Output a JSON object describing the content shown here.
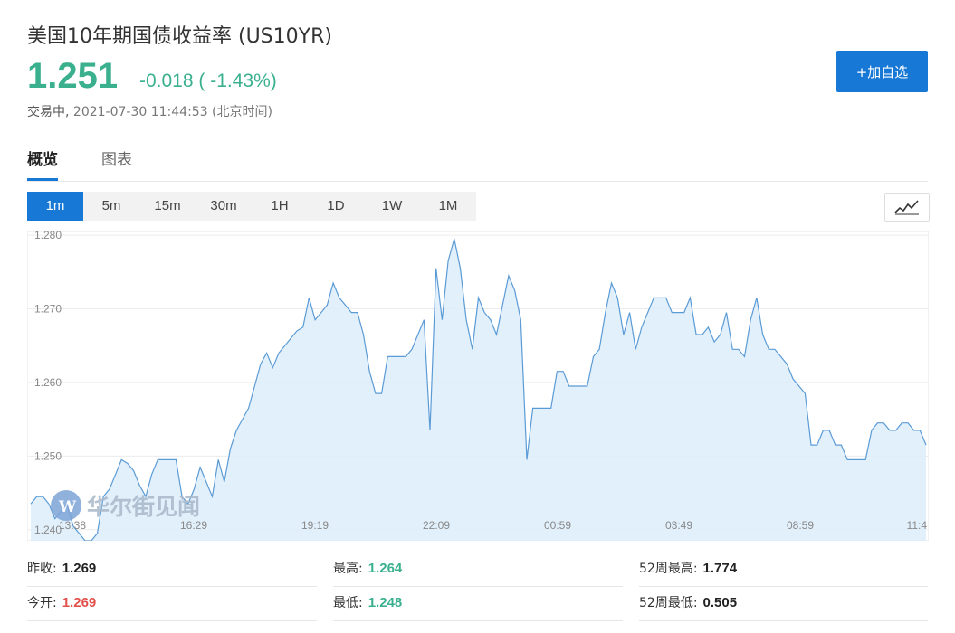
{
  "header": {
    "title": "美国10年期国债收益率 (US10YR)",
    "price": "1.251",
    "change": "-0.018 ( -1.43%)",
    "status_label": "交易中,",
    "timestamp": "2021-07-30 11:44:53 (北京时间)",
    "add_button": "+加自选"
  },
  "tabs": [
    {
      "label": "概览"
    },
    {
      "label": "图表"
    }
  ],
  "periods": [
    {
      "label": "1m"
    },
    {
      "label": "5m"
    },
    {
      "label": "15m"
    },
    {
      "label": "30m"
    },
    {
      "label": "1H"
    },
    {
      "label": "1D"
    },
    {
      "label": "1W"
    },
    {
      "label": "1M"
    }
  ],
  "active_period": "1m",
  "chart_type_icon": "line-chart-icon",
  "colors": {
    "accent": "#1878d6",
    "up": "#e3514c",
    "down": "#3bb08f",
    "line": "#5b9bd5",
    "fill": "#ddedfb"
  },
  "watermark": "华尔街见闻",
  "chart_data": {
    "type": "area",
    "title": "",
    "xlabel": "",
    "ylabel": "",
    "ylim": [
      1.2385,
      1.2805
    ],
    "yticks": [
      1.24,
      1.25,
      1.26,
      1.27,
      1.28
    ],
    "ytick_labels": [
      "1.240",
      "1.250",
      "1.260",
      "1.270",
      "1.280"
    ],
    "xtick_labels": [
      "13:38",
      "16:29",
      "19:19",
      "22:09",
      "00:59",
      "03:49",
      "08:59",
      "11:4"
    ],
    "grid": true,
    "series": [
      {
        "values": [
          1.2435,
          1.2445,
          1.2445,
          1.2435,
          1.2415,
          1.2425,
          1.2435,
          1.2405,
          1.2395,
          1.2385,
          1.2385,
          1.2395,
          1.2445,
          1.2455,
          1.2475,
          1.2495,
          1.249,
          1.248,
          1.246,
          1.2445,
          1.2475,
          1.2495,
          1.2495,
          1.2495,
          1.2495,
          1.2445,
          1.2435,
          1.2455,
          1.2485,
          1.2465,
          1.2445,
          1.2495,
          1.2465,
          1.251,
          1.2535,
          1.255,
          1.2565,
          1.2595,
          1.2625,
          1.264,
          1.262,
          1.264,
          1.265,
          1.266,
          1.267,
          1.2675,
          1.2715,
          1.2685,
          1.2695,
          1.2705,
          1.2735,
          1.2715,
          1.2705,
          1.2695,
          1.2695,
          1.2665,
          1.2615,
          1.2585,
          1.2585,
          1.2635,
          1.2635,
          1.2635,
          1.2635,
          1.2645,
          1.2665,
          1.2685,
          1.2535,
          1.2755,
          1.2685,
          1.2765,
          1.2795,
          1.2755,
          1.2685,
          1.2645,
          1.2715,
          1.2695,
          1.2685,
          1.2665,
          1.2705,
          1.2745,
          1.2725,
          1.2685,
          1.2495,
          1.2565,
          1.2565,
          1.2565,
          1.2565,
          1.2615,
          1.2615,
          1.2595,
          1.2595,
          1.2595,
          1.2595,
          1.2635,
          1.2645,
          1.2695,
          1.2735,
          1.2715,
          1.2665,
          1.2695,
          1.2645,
          1.2675,
          1.2695,
          1.2715,
          1.2715,
          1.2715,
          1.2695,
          1.2695,
          1.2695,
          1.2715,
          1.2665,
          1.2665,
          1.2675,
          1.2655,
          1.2665,
          1.2695,
          1.2645,
          1.2645,
          1.2635,
          1.2685,
          1.2715,
          1.2665,
          1.2645,
          1.2645,
          1.2635,
          1.2625,
          1.2605,
          1.2595,
          1.2585,
          1.2515,
          1.2515,
          1.2535,
          1.2535,
          1.2515,
          1.2515,
          1.2495,
          1.2495,
          1.2495,
          1.2495,
          1.2535,
          1.2545,
          1.2545,
          1.2535,
          1.2535,
          1.2545,
          1.2545,
          1.2535,
          1.2535,
          1.2515
        ]
      }
    ]
  },
  "stats": {
    "prev_close": {
      "label": "昨收:",
      "value": "1.269"
    },
    "open": {
      "label": "今开:",
      "value": "1.269"
    },
    "high": {
      "label": "最高:",
      "value": "1.264"
    },
    "low": {
      "label": "最低:",
      "value": "1.248"
    },
    "high_52w": {
      "label": "52周最高:",
      "value": "1.774"
    },
    "low_52w": {
      "label": "52周最低:",
      "value": "0.505"
    }
  }
}
